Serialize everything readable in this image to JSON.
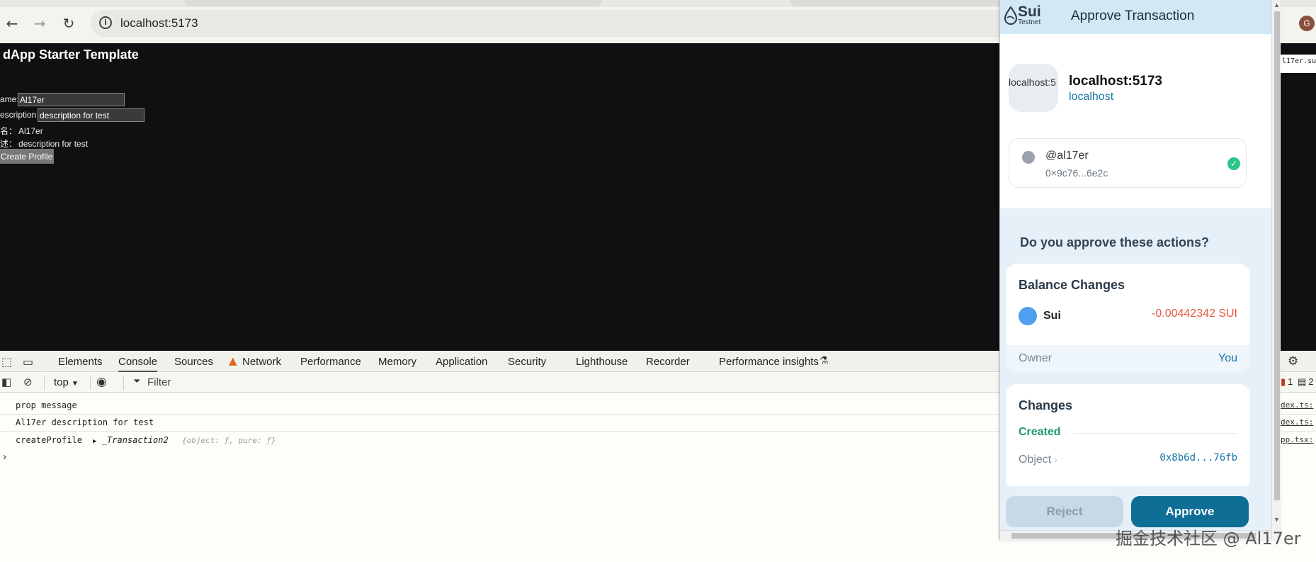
{
  "browser": {
    "url": "localhost:5173",
    "avatar_letter": "G",
    "right_edge_text": "l17er.su"
  },
  "app": {
    "title": "dApp Starter Template",
    "name_label": "ame:",
    "name_value": "Al17er",
    "desc_label": "escription",
    "desc_value": "description for test",
    "name_display_label": "名：",
    "name_display_value": "Al17er",
    "desc_display_label": "述：",
    "desc_display_value": "description for test",
    "create_button": "Create Profile"
  },
  "devtools": {
    "tabs": [
      "Elements",
      "Console",
      "Sources",
      "Network",
      "Performance",
      "Memory",
      "Application",
      "Security",
      "Lighthouse",
      "Recorder",
      "Performance insights"
    ],
    "context": "top",
    "filter_placeholder": "Filter",
    "error_count": "1",
    "message_count": "2",
    "logs": [
      {
        "text": "prop message",
        "source": "dex.ts:"
      },
      {
        "text": "Al17er  description for test",
        "source": "dex.ts:"
      },
      {
        "text": "createProfile",
        "source": "pp.tsx:"
      }
    ],
    "log_object_name": "_Transaction2",
    "log_object_preview": "{object: ƒ, pure: ƒ}",
    "prompt": "›"
  },
  "wallet": {
    "logo": "Sui",
    "network": "Testnet",
    "title": "Approve Transaction",
    "site_icon_alt": "localhost:5",
    "site_name": "localhost:5173",
    "site_host": "localhost",
    "account_name": "@al17er",
    "account_address": "0×9c76...6e2c",
    "question": "Do you approve these actions?",
    "balance": {
      "title": "Balance Changes",
      "coin": "Sui",
      "amount": "-0.00442342 SUI",
      "owner_label": "Owner",
      "owner_value": "You"
    },
    "changes": {
      "title": "Changes",
      "created_label": "Created",
      "object_label": "Object",
      "object_id": "0x8b6d...76fb"
    },
    "reject_label": "Reject",
    "approve_label": "Approve"
  },
  "watermark": "掘金技术社区 @ Al17er",
  "colors": {
    "viewport_bg": "#101013",
    "wallet_accent": "#0e6e95",
    "negative_amount": "#e3583f",
    "created_green": "#1a9a6d",
    "link_blue": "#1874a6"
  }
}
